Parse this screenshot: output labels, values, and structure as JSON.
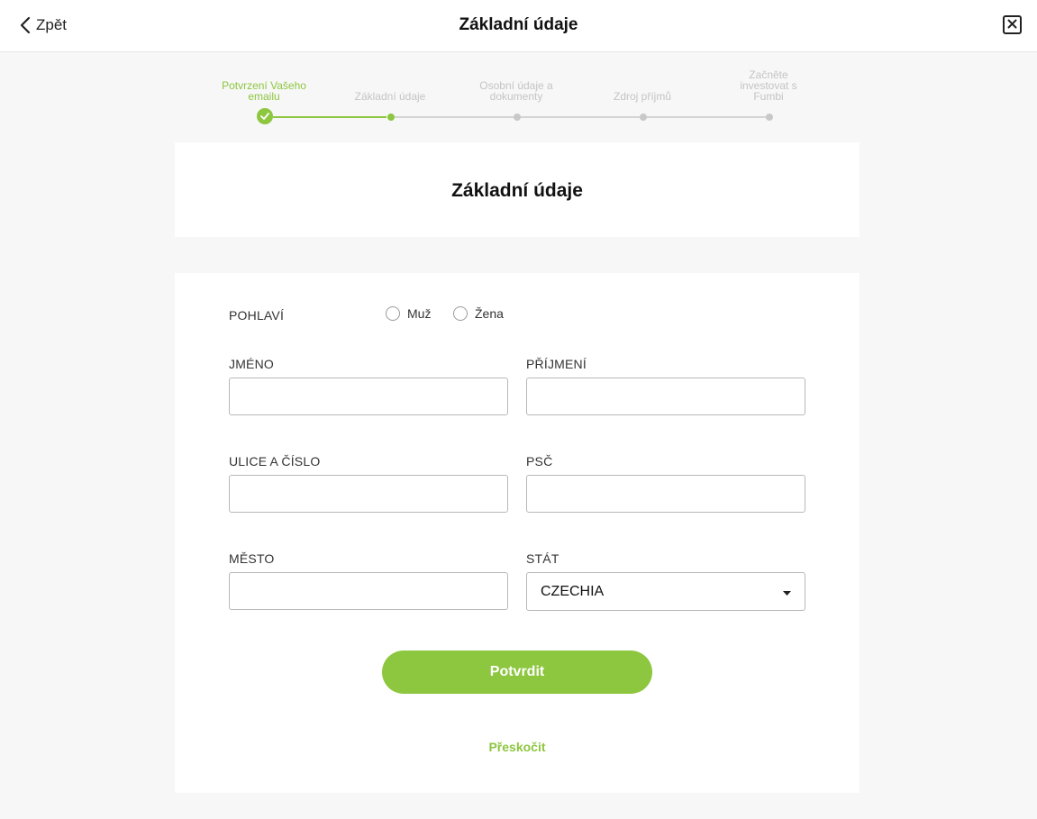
{
  "header": {
    "back_label": "Zpět",
    "title": "Základní údaje"
  },
  "stepper": {
    "steps": [
      {
        "label": "Potvrzení Vašeho emailu",
        "state": "done"
      },
      {
        "label": "Základní údaje",
        "state": "active"
      },
      {
        "label": "Osobní údaje a dokumenty",
        "state": "pending"
      },
      {
        "label": "Zdroj příjmů",
        "state": "pending"
      },
      {
        "label": "Začněte investovat s Fumbi",
        "state": "pending"
      }
    ]
  },
  "section_title": "Základní údaje",
  "form": {
    "gender_label": "POHLAVÍ",
    "gender_options": [
      "Muž",
      "Žena"
    ],
    "first_name_label": "JMÉNO",
    "first_name_value": "",
    "last_name_label": "PŘÍJMENÍ",
    "last_name_value": "",
    "street_label": "ULICE A ČÍSLO",
    "street_value": "",
    "zip_label": "PSČ",
    "zip_value": "",
    "city_label": "MĚSTO",
    "city_value": "",
    "country_label": "STÁT",
    "country_value": "CZECHIA",
    "confirm_label": "Potvrdit",
    "skip_label": "Přeskočit"
  },
  "colors": {
    "accent": "#8dc63f",
    "background": "#f7f7f7",
    "card": "#ffffff",
    "pending": "#c8c8c8"
  }
}
